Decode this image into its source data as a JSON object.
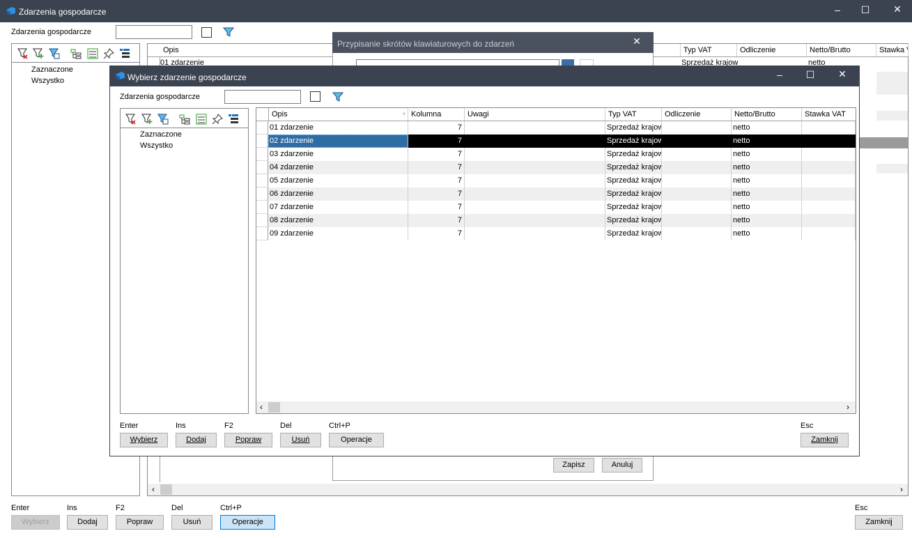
{
  "main_window": {
    "title": "Zdarzenia gospodarcze",
    "filter_label": "Zdarzenia gospodarcze",
    "filter_value": "",
    "tree": [
      "Zaznaczone",
      "Wszystko"
    ],
    "columns": [
      "Opis",
      "Typ VAT",
      "Odliczenie",
      "Netto/Brutto",
      "Stawka V"
    ],
    "first_row": {
      "opis": "01 zdarzenie",
      "typ_vat": "Sprzedaż krajow",
      "netto": "netto"
    },
    "hotkeys": [
      "Enter",
      "Ins",
      "F2",
      "Del",
      "Ctrl+P",
      "Esc"
    ],
    "buttons": {
      "select": "Wybierz",
      "add": "Dodaj",
      "edit": "Popraw",
      "delete": "Usuń",
      "ops": "Operacje",
      "close": "Zamknij"
    }
  },
  "shortcut_dialog": {
    "title": "Przypisanie skrótów klawiaturowych do zdarzeń",
    "save_label": "Zapisz",
    "cancel_label": "Anuluj"
  },
  "select_dialog": {
    "title": "Wybierz zdarzenie gospodarcze",
    "filter_label": "Zdarzenia gospodarcze",
    "filter_value": "",
    "tree": [
      "Zaznaczone",
      "Wszystko"
    ],
    "columns": [
      "Opis",
      "Kolumna",
      "Uwagi",
      "Typ VAT",
      "Odliczenie",
      "Netto/Brutto",
      "Stawka VAT"
    ],
    "rows": [
      {
        "opis": "01 zdarzenie",
        "kolumna": "7",
        "uwagi": "",
        "typ_vat": "Sprzedaż krajow",
        "odliczenie": "",
        "netto_brutto": "netto",
        "stawka": ""
      },
      {
        "opis": "02 zdarzenie",
        "kolumna": "7",
        "uwagi": "",
        "typ_vat": "Sprzedaż krajow",
        "odliczenie": "",
        "netto_brutto": "netto",
        "stawka": ""
      },
      {
        "opis": "03 zdarzenie",
        "kolumna": "7",
        "uwagi": "",
        "typ_vat": "Sprzedaż krajow",
        "odliczenie": "",
        "netto_brutto": "netto",
        "stawka": ""
      },
      {
        "opis": "04 zdarzenie",
        "kolumna": "7",
        "uwagi": "",
        "typ_vat": "Sprzedaż krajow",
        "odliczenie": "",
        "netto_brutto": "netto",
        "stawka": ""
      },
      {
        "opis": "05 zdarzenie",
        "kolumna": "7",
        "uwagi": "",
        "typ_vat": "Sprzedaż krajow",
        "odliczenie": "",
        "netto_brutto": "netto",
        "stawka": ""
      },
      {
        "opis": "06 zdarzenie",
        "kolumna": "7",
        "uwagi": "",
        "typ_vat": "Sprzedaż krajow",
        "odliczenie": "",
        "netto_brutto": "netto",
        "stawka": ""
      },
      {
        "opis": "07 zdarzenie",
        "kolumna": "7",
        "uwagi": "",
        "typ_vat": "Sprzedaż krajow",
        "odliczenie": "",
        "netto_brutto": "netto",
        "stawka": ""
      },
      {
        "opis": "08 zdarzenie",
        "kolumna": "7",
        "uwagi": "",
        "typ_vat": "Sprzedaż krajow",
        "odliczenie": "",
        "netto_brutto": "netto",
        "stawka": ""
      },
      {
        "opis": "09 zdarzenie",
        "kolumna": "7",
        "uwagi": "",
        "typ_vat": "Sprzedaż krajow",
        "odliczenie": "",
        "netto_brutto": "netto",
        "stawka": ""
      }
    ],
    "hotkeys": [
      "Enter",
      "Ins",
      "F2",
      "Del",
      "Ctrl+P",
      "Esc"
    ],
    "buttons": {
      "select": "Wybierz",
      "add": "Dodaj",
      "edit": "Popraw",
      "delete": "Usuń",
      "ops": "Operacje",
      "close": "Zamknij"
    }
  },
  "colors": {
    "titlebar": "#3b4351",
    "selection": "#2e6da4",
    "accent_blue": "#1e73be"
  }
}
